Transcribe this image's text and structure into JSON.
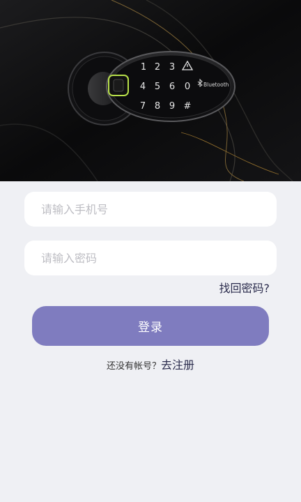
{
  "keypad": {
    "keys": [
      "1",
      "2",
      "3",
      "4",
      "5",
      "6",
      "7",
      "8",
      "9",
      "0",
      "#"
    ],
    "brand": "Bluetooth",
    "alarm_icon": "warning-triangle-icon",
    "bluetooth_icon": "bluetooth-icon",
    "fingerprint_icon": "fingerprint-sensor-icon"
  },
  "form": {
    "phone_placeholder": "请输入手机号",
    "password_placeholder": "请输入密码",
    "forgot_label": "找回密码?",
    "login_label": "登录",
    "no_account_label": "还没有帐号？",
    "register_label": "去注册"
  },
  "colors": {
    "accent": "#7f7cbf",
    "background": "#eff0f4",
    "link": "#2b2c4d",
    "fingerprint_glow": "#b8e04a"
  }
}
